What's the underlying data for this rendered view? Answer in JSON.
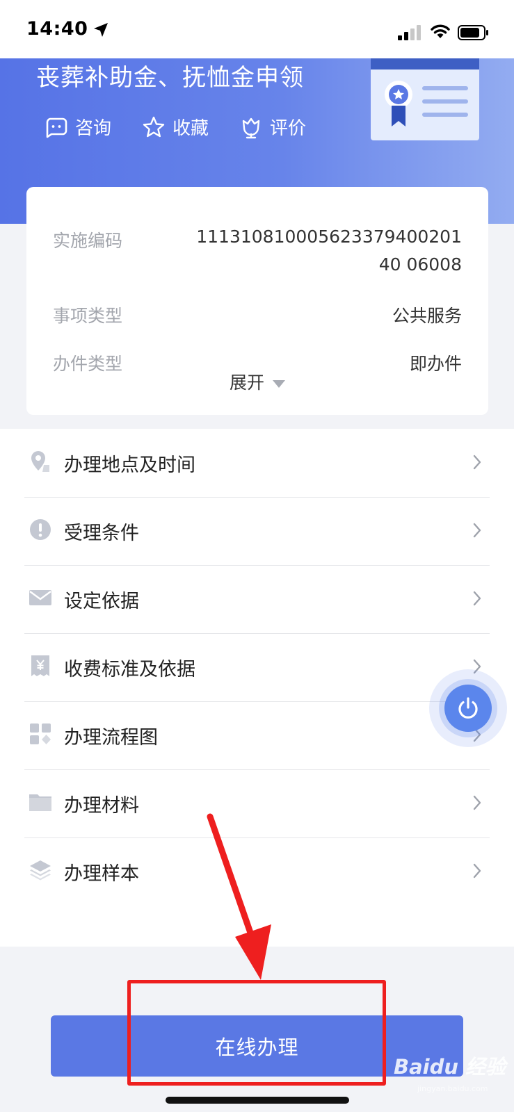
{
  "status_bar": {
    "time": "14:40"
  },
  "hero": {
    "title": "丧葬补助金、抚恤金申领",
    "actions": [
      {
        "label": "咨询",
        "icon": "chat-bubble-icon"
      },
      {
        "label": "收藏",
        "icon": "star-icon"
      },
      {
        "label": "评价",
        "icon": "flower-icon"
      }
    ]
  },
  "info": {
    "rows": [
      {
        "label": "实施编码",
        "value": "11131081000562337940020140 06008"
      },
      {
        "label": "事项类型",
        "value": "公共服务"
      },
      {
        "label": "办件类型",
        "value": "即办件"
      }
    ],
    "expand_label": "展开"
  },
  "menu": {
    "items": [
      {
        "label": "办理地点及时间",
        "icon": "location-pin-icon"
      },
      {
        "label": "受理条件",
        "icon": "exclamation-icon"
      },
      {
        "label": "设定依据",
        "icon": "envelope-icon"
      },
      {
        "label": "收费标准及依据",
        "icon": "yen-receipt-icon"
      },
      {
        "label": "办理流程图",
        "icon": "grid-icon"
      },
      {
        "label": "办理材料",
        "icon": "folder-icon"
      },
      {
        "label": "办理样本",
        "icon": "layers-icon"
      }
    ]
  },
  "bottom": {
    "online_button": "在线办理"
  },
  "watermark": {
    "text": "Baidu 经验",
    "sub": "jingyan.baidu.com"
  },
  "colors": {
    "primary": "#5a78e4",
    "annotation": "#ee1f1f"
  }
}
